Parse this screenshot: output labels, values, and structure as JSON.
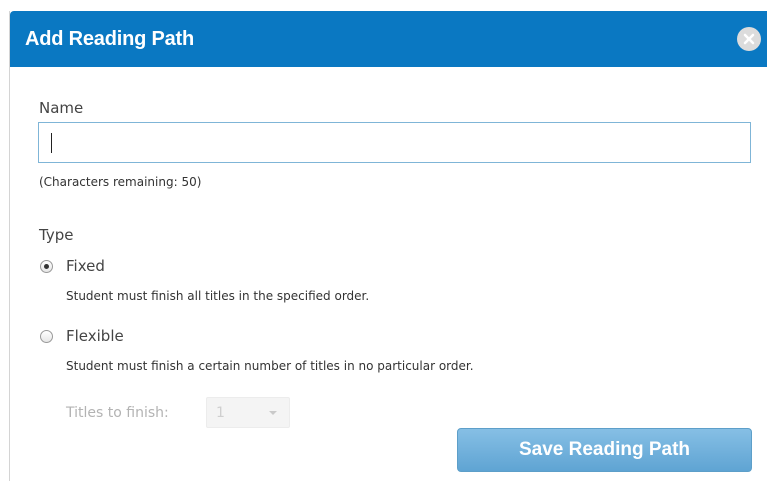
{
  "dialog": {
    "title": "Add Reading Path",
    "close_icon": "close-circle-x-icon"
  },
  "name_field": {
    "label": "Name",
    "value": "",
    "hint": "(Characters remaining: 50)"
  },
  "type": {
    "label": "Type",
    "selected": "Fixed",
    "options": [
      {
        "label": "Fixed",
        "description": "Student must finish all titles in the specified order.",
        "checked": true
      },
      {
        "label": "Flexible",
        "description": "Student must finish a certain number of titles in no particular order.",
        "checked": false
      }
    ]
  },
  "titles_to_finish": {
    "label": "Titles to finish:",
    "value": "1",
    "disabled": true
  },
  "save_button": {
    "label": "Save Reading Path"
  },
  "colors": {
    "header": "#0a78c2",
    "button": "#6aaed9",
    "input_border": "#7fb5d7"
  }
}
